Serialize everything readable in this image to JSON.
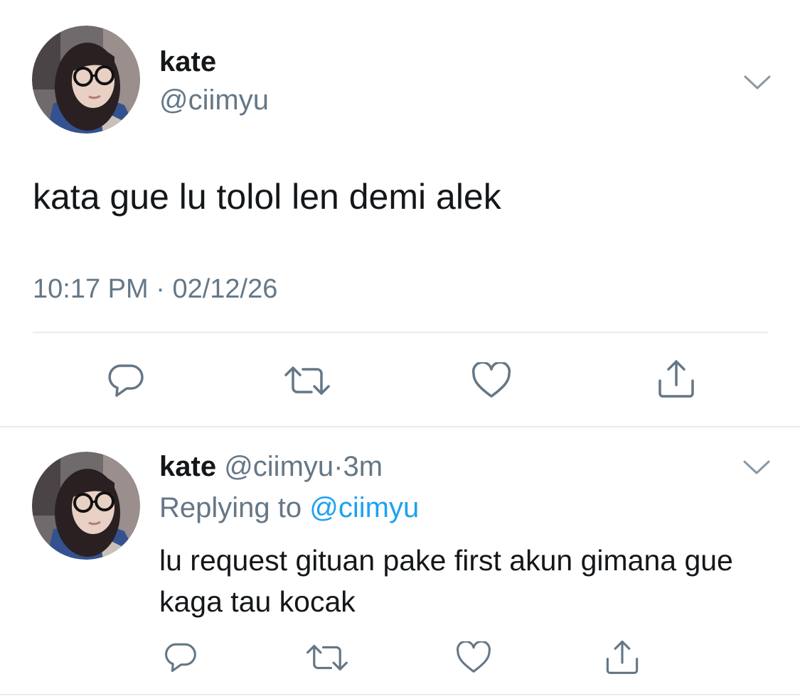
{
  "tweet": {
    "author": {
      "display_name": "kate",
      "handle": "@ciimyu",
      "avatar_icon": "profile-photo"
    },
    "text": "kata gue lu tolol len demi alek",
    "time": "10:17 PM",
    "separator": "·",
    "date": "02/12/26",
    "actions": [
      "reply-icon",
      "retweet-icon",
      "like-icon",
      "share-icon"
    ]
  },
  "reply": {
    "author": {
      "display_name": "kate",
      "handle": "@ciimyu",
      "avatar_icon": "profile-photo"
    },
    "separator": "·",
    "age": "3m",
    "replying_label": "Replying to",
    "replying_to": "@ciimyu",
    "text": "lu request gituan pake first akun gimana gue kaga tau kocak",
    "actions": [
      "reply-icon",
      "retweet-icon",
      "like-icon",
      "share-icon"
    ]
  },
  "colors": {
    "text": "#14171a",
    "secondary": "#657786",
    "mention": "#1da1f2",
    "divider": "#e6ecf0",
    "icon": "#657786"
  }
}
